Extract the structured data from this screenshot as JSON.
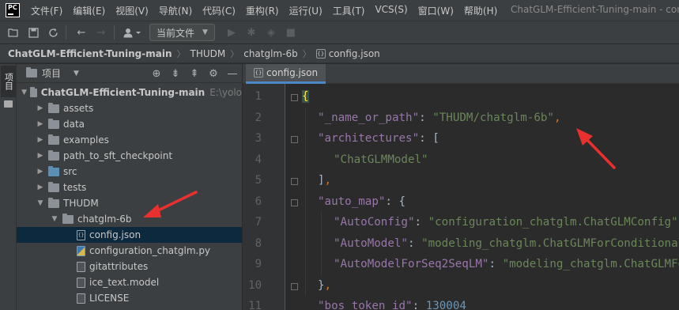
{
  "app": {
    "logo_text": "PC",
    "window_title": "ChatGLM-Efficient-Tuning-main - con"
  },
  "menu": [
    "文件(F)",
    "编辑(E)",
    "视图(V)",
    "导航(N)",
    "代码(C)",
    "重构(R)",
    "运行(U)",
    "工具(T)",
    "VCS(S)",
    "窗口(W)",
    "帮助(H)"
  ],
  "toolbar": {
    "run_config_label": "当前文件"
  },
  "breadcrumb": {
    "items": [
      "ChatGLM-Efficient-Tuning-main",
      "THUDM",
      "chatglm-6b",
      "config.json"
    ]
  },
  "left_strip": {
    "tab_label": "项目"
  },
  "project_panel": {
    "title": "项目",
    "root": {
      "label": "ChatGLM-Efficient-Tuning-main",
      "path_hint": "E:\\yolo"
    },
    "items": [
      {
        "label": "assets",
        "kind": "folder",
        "depth": 1,
        "expanded": false
      },
      {
        "label": "data",
        "kind": "folder",
        "depth": 1,
        "expanded": false
      },
      {
        "label": "examples",
        "kind": "folder",
        "depth": 1,
        "expanded": false
      },
      {
        "label": "path_to_sft_checkpoint",
        "kind": "folder",
        "depth": 1,
        "expanded": false
      },
      {
        "label": "src",
        "kind": "folder-source",
        "depth": 1,
        "expanded": false
      },
      {
        "label": "tests",
        "kind": "folder",
        "depth": 1,
        "expanded": false
      },
      {
        "label": "THUDM",
        "kind": "folder",
        "depth": 1,
        "expanded": true
      },
      {
        "label": "chatglm-6b",
        "kind": "folder",
        "depth": 2,
        "expanded": true
      },
      {
        "label": "config.json",
        "kind": "json",
        "depth": 3,
        "selected": true
      },
      {
        "label": "configuration_chatglm.py",
        "kind": "py",
        "depth": 3
      },
      {
        "label": "gitattributes",
        "kind": "text",
        "depth": 3
      },
      {
        "label": "ice_text.model",
        "kind": "text",
        "depth": 3
      },
      {
        "label": "LICENSE",
        "kind": "text",
        "depth": 3
      }
    ]
  },
  "editor": {
    "tab_label": "config.json",
    "line_numbers": [
      "1",
      "2",
      "3",
      "4",
      "5",
      "6",
      "7",
      "8",
      "9",
      "10",
      "11"
    ],
    "lines": [
      {
        "indent": 0,
        "parts": [
          {
            "t": "{",
            "c": "brace-hl"
          }
        ]
      },
      {
        "indent": 1,
        "parts": [
          {
            "t": "\"_name_or_path\"",
            "c": "c-key"
          },
          {
            "t": ": ",
            "c": "c-brace"
          },
          {
            "t": "\"THUDM/chatglm-6b\"",
            "c": "c-str"
          },
          {
            "t": ",",
            "c": "c-punc"
          }
        ]
      },
      {
        "indent": 1,
        "parts": [
          {
            "t": "\"architectures\"",
            "c": "c-key"
          },
          {
            "t": ": ",
            "c": "c-brace"
          },
          {
            "t": "[",
            "c": "c-brace"
          }
        ]
      },
      {
        "indent": 2,
        "parts": [
          {
            "t": "\"ChatGLMModel\"",
            "c": "c-str"
          }
        ]
      },
      {
        "indent": 1,
        "parts": [
          {
            "t": "]",
            "c": "c-brace"
          },
          {
            "t": ",",
            "c": "c-punc"
          }
        ]
      },
      {
        "indent": 1,
        "parts": [
          {
            "t": "\"auto_map\"",
            "c": "c-key"
          },
          {
            "t": ": ",
            "c": "c-brace"
          },
          {
            "t": "{",
            "c": "c-brace"
          }
        ]
      },
      {
        "indent": 2,
        "parts": [
          {
            "t": "\"AutoConfig\"",
            "c": "c-key"
          },
          {
            "t": ": ",
            "c": "c-brace"
          },
          {
            "t": "\"configuration_chatglm.ChatGLMConfig\"",
            "c": "c-str"
          }
        ]
      },
      {
        "indent": 2,
        "parts": [
          {
            "t": "\"AutoModel\"",
            "c": "c-key"
          },
          {
            "t": ": ",
            "c": "c-brace"
          },
          {
            "t": "\"modeling_chatglm.ChatGLMForConditionalGeneration\"",
            "c": "c-str"
          }
        ]
      },
      {
        "indent": 2,
        "parts": [
          {
            "t": "\"AutoModelForSeq2SeqLM\"",
            "c": "c-key"
          },
          {
            "t": ": ",
            "c": "c-brace"
          },
          {
            "t": "\"modeling_chatglm.ChatGLMForConditionalGeneration\"",
            "c": "c-str"
          }
        ]
      },
      {
        "indent": 1,
        "parts": [
          {
            "t": "}",
            "c": "c-brace"
          },
          {
            "t": ",",
            "c": "c-punc"
          }
        ]
      },
      {
        "indent": 1,
        "parts": [
          {
            "t": "\"bos_token_id\"",
            "c": "c-key"
          },
          {
            "t": ": ",
            "c": "c-brace"
          },
          {
            "t": "130004",
            "c": "c-num"
          }
        ]
      }
    ]
  },
  "annotation_color": "#e8312f",
  "icons": {
    "back": "arrow-left-icon",
    "forward": "arrow-right-icon",
    "save": "save-icon",
    "sync": "sync-icon",
    "open": "folder-open-icon",
    "user": "user-icon",
    "run": "run-icon",
    "debug": "debug-icon",
    "coverage": "coverage-icon",
    "stop": "stop-icon"
  }
}
